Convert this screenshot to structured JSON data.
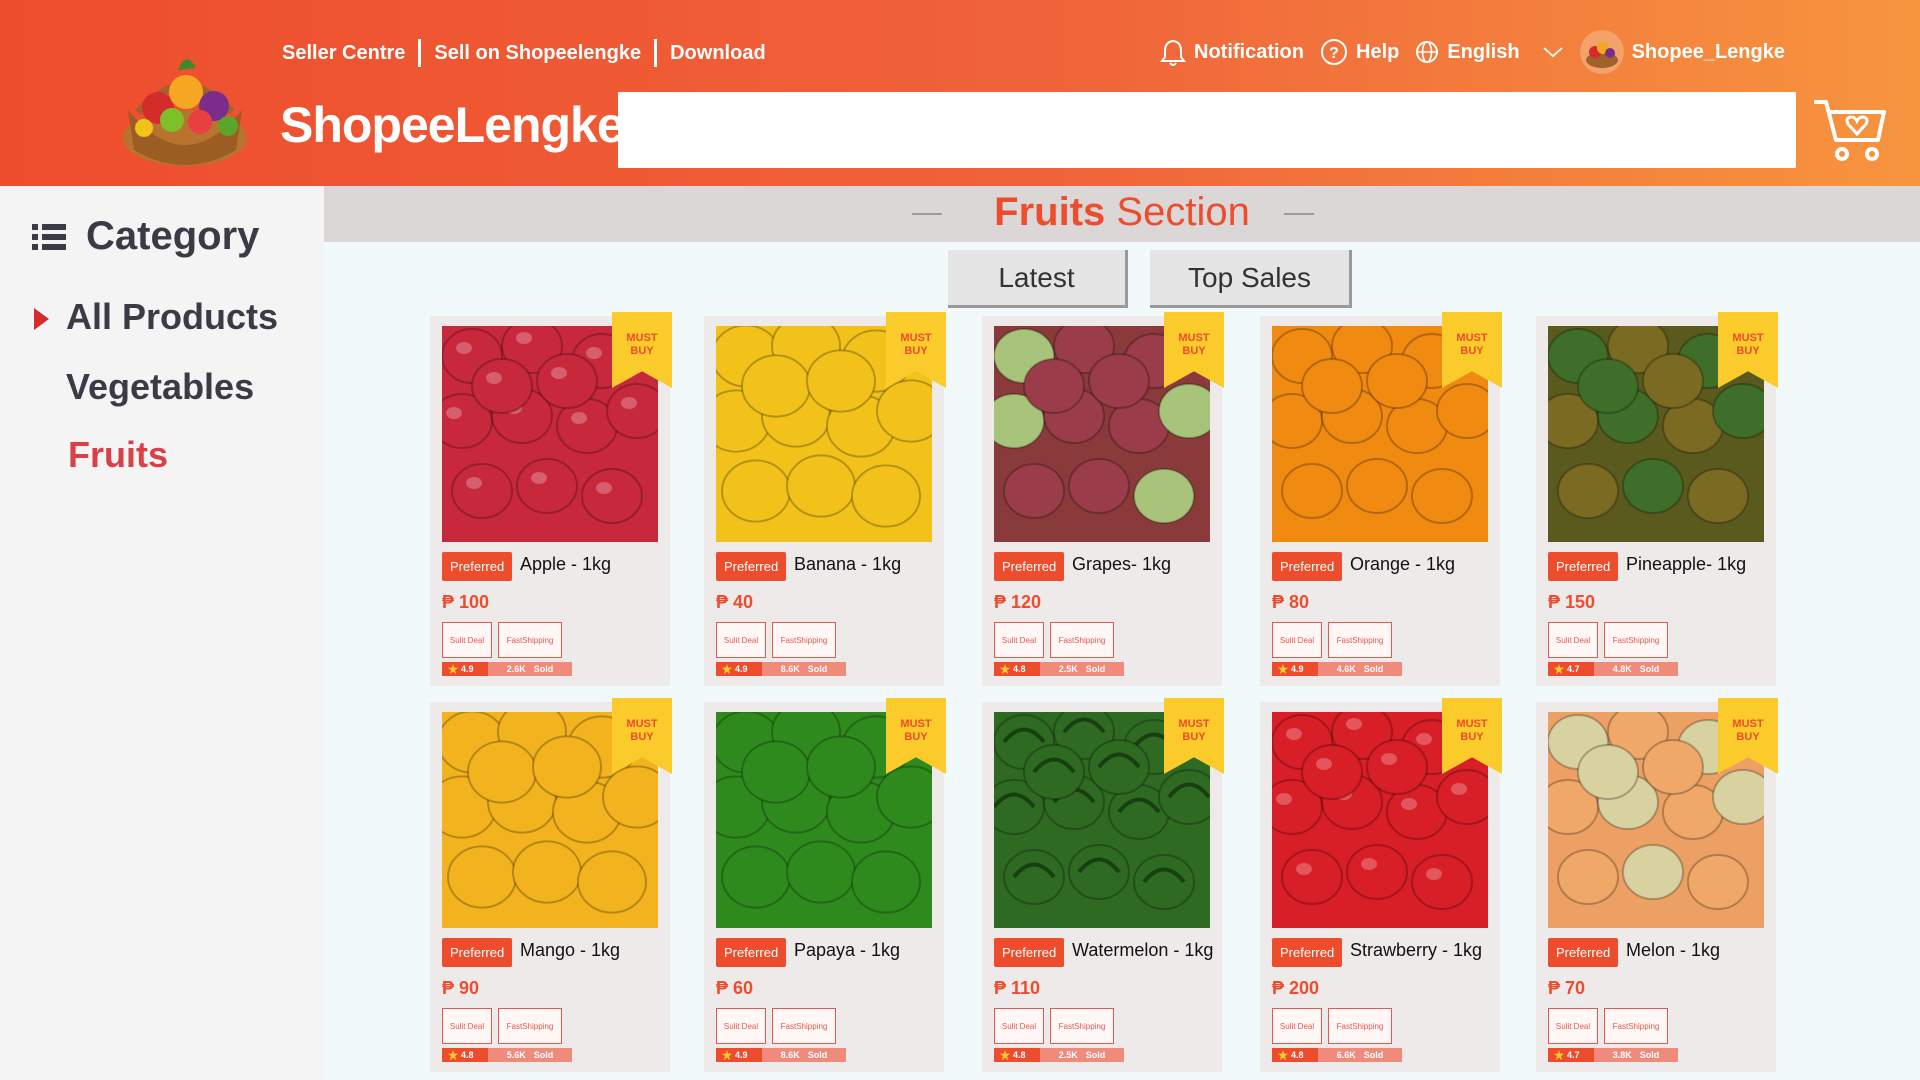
{
  "header": {
    "links": [
      "Seller Centre",
      "Sell on Shopeelengke",
      "Download"
    ],
    "brand": "ShopeeLengke",
    "search_placeholder": "",
    "notification": "Notification",
    "help": "Help",
    "language": "English",
    "username": "Shopee_Lengke"
  },
  "sidebar": {
    "heading": "Category",
    "items": [
      "All Products",
      "Vegetables",
      "Fruits"
    ],
    "active": "Fruits"
  },
  "main": {
    "section_title_bold": "Fruits",
    "section_title_rest": "Section",
    "sort_latest": "Latest",
    "sort_top": "Top Sales"
  },
  "labels": {
    "must": "MUST",
    "buy": "BUY",
    "preferred": "Preferred",
    "deal": "Sulit Deal",
    "ship1": "Fast",
    "ship2": "Shipping",
    "sold": "Sold"
  },
  "products": [
    {
      "name": "Apple - 1kg",
      "price": "₱ 100",
      "rating": "4.9",
      "sold": "2.6K"
    },
    {
      "name": "Banana - 1kg",
      "price": "₱ 40",
      "rating": "4.9",
      "sold": "8.6K"
    },
    {
      "name": "Grapes- 1kg",
      "price": "₱ 120",
      "rating": "4.8",
      "sold": "2.5K"
    },
    {
      "name": "Orange - 1kg",
      "price": "₱ 80",
      "rating": "4.9",
      "sold": "4.6K"
    },
    {
      "name": "Pineapple- 1kg",
      "price": "₱ 150",
      "rating": "4.7",
      "sold": "4.8K"
    },
    {
      "name": "Mango - 1kg",
      "price": "₱ 90",
      "rating": "4.8",
      "sold": "5.6K"
    },
    {
      "name": "Papaya - 1kg",
      "price": "₱ 60",
      "rating": "4.9",
      "sold": "8.6K"
    },
    {
      "name": "Watermelon - 1kg",
      "price": "₱ 110",
      "rating": "4.8",
      "sold": "2.5K"
    },
    {
      "name": "Strawberry - 1kg",
      "price": "₱ 200",
      "rating": "4.8",
      "sold": "6.6K"
    },
    {
      "name": "Melon - 1kg",
      "price": "₱ 70",
      "rating": "4.7",
      "sold": "3.8K"
    }
  ],
  "colors": {
    "brand": "#ee4d2d",
    "ribbon": "#fbcb2c",
    "sidebar_active": "#d94048",
    "apple": "#c8283c",
    "banana": "#f2c21a",
    "grapes": "#8a3a3a",
    "orange": "#f08a10",
    "pineapple": "#5a5a1e",
    "mango": "#f2b31e",
    "papaya": "#2f8a1e",
    "watermelon": "#2f6a22",
    "strawberry": "#d81e26",
    "melon": "#eda064"
  }
}
